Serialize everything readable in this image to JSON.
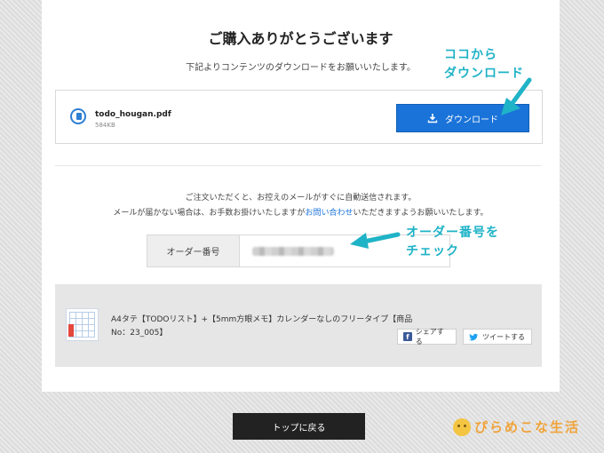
{
  "page": {
    "title": "ご購入ありがとうございます",
    "subtitle": "下記よりコンテンツのダウンロードをお願いいたします。"
  },
  "file": {
    "name": "todo_hougan.pdf",
    "size": "584KB",
    "download_label": "ダウンロード",
    "icon": "document-icon"
  },
  "notice": {
    "line1": "ご注文いただくと、お控えのメールがすぐに自動送信されます。",
    "line2_before": "メールが届かない場合は、お手数お掛けいたしますが",
    "line2_link": "お問い合わせ",
    "line2_after": "いただきますようお願いいたします。"
  },
  "order": {
    "label": "オーダー番号",
    "value_hidden": "blurred"
  },
  "product": {
    "title": "A4タテ【TODOリスト】+【5mm方眼メモ】カレンダーなしのフリータイプ【商品No：23_005】",
    "share_facebook": "シェアする",
    "share_twitter": "ツイートする"
  },
  "footer": {
    "back_label": "トップに戻る"
  },
  "annotations": {
    "download_hint_line1": "ココから",
    "download_hint_line2": "ダウンロード",
    "order_hint_line1": "オーダー番号を",
    "order_hint_line2": "チェック"
  },
  "branding": {
    "logo_text": "ぴらめこな生活"
  },
  "colors": {
    "accent": "#1a73d9",
    "annotation": "#1fb3c7",
    "logo": "#f0a33a"
  }
}
